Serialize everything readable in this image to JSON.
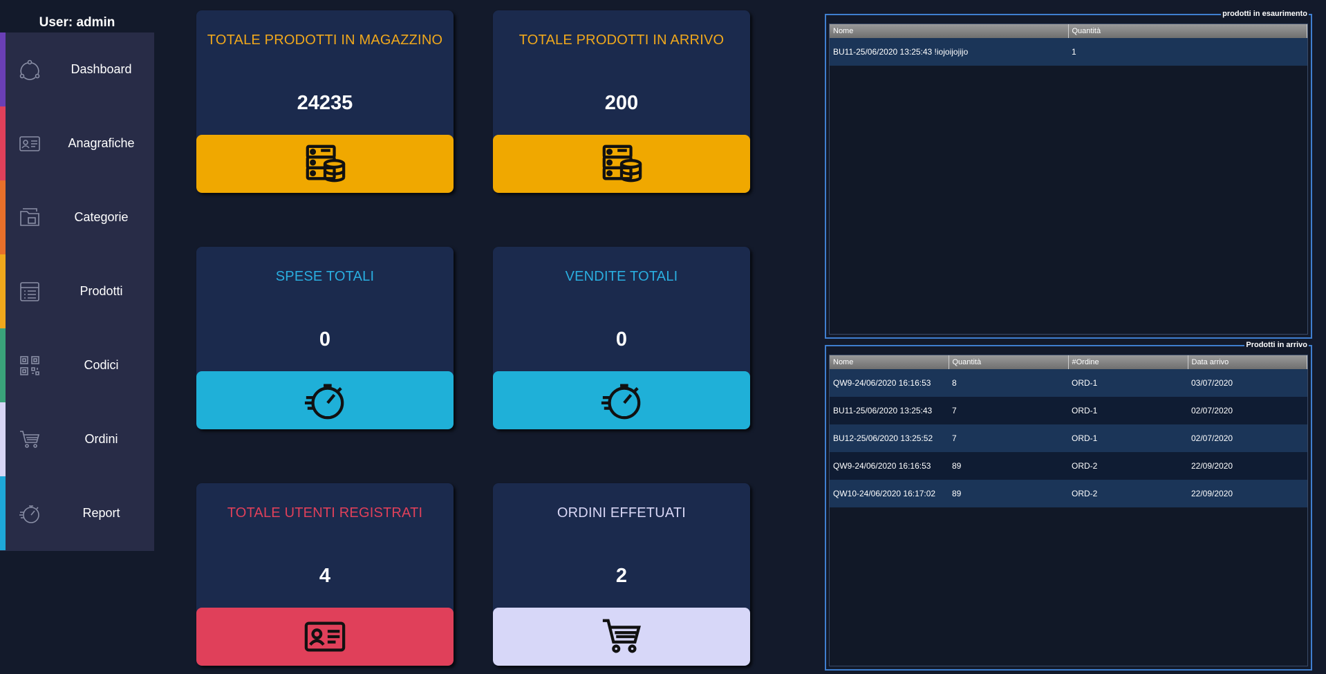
{
  "user_label": "User: admin",
  "sidebar": {
    "items": [
      {
        "label": "Dashboard",
        "icon": "dashboard-icon",
        "color": "#6a3fb5"
      },
      {
        "label": "Anagrafiche",
        "icon": "id-card-icon",
        "color": "#e0405a"
      },
      {
        "label": "Categorie",
        "icon": "folder-icon",
        "color": "#e8702a"
      },
      {
        "label": "Prodotti",
        "icon": "list-icon",
        "color": "#f0a81c"
      },
      {
        "label": "Codici",
        "icon": "qr-code-icon",
        "color": "#3aa37a"
      },
      {
        "label": "Ordini",
        "icon": "cart-icon",
        "color": "#d8d6f5"
      },
      {
        "label": "Report",
        "icon": "stopwatch-icon",
        "color": "#1ea8d8"
      }
    ]
  },
  "cards": [
    {
      "title": "TOTALE PRODOTTI IN MAGAZZINO",
      "value": "24235",
      "title_color": "#f0a81c",
      "bottom_color": "#f0a800",
      "icon": "database-icon"
    },
    {
      "title": "TOTALE PRODOTTI IN ARRIVO",
      "value": "200",
      "title_color": "#f0a81c",
      "bottom_color": "#f0a800",
      "icon": "database-icon"
    },
    {
      "title": "SPESE TOTALI",
      "value": "0",
      "title_color": "#2aaee0",
      "bottom_color": "#1fb0d8",
      "icon": "stopwatch-icon"
    },
    {
      "title": "VENDITE TOTALI",
      "value": "0",
      "title_color": "#2aaee0",
      "bottom_color": "#1fb0d8",
      "icon": "stopwatch-icon"
    },
    {
      "title": "TOTALE UTENTI REGISTRATI",
      "value": "4",
      "title_color": "#e0405a",
      "bottom_color": "#e0405a",
      "icon": "id-card-icon"
    },
    {
      "title": "ORDINI EFFETUATI",
      "value": "2",
      "title_color": "#d8d6f5",
      "bottom_color": "#d7d7f8",
      "icon": "cart-icon"
    }
  ],
  "low_stock": {
    "title": "prodotti in esaurimento",
    "columns": [
      "Nome",
      "Quantità"
    ],
    "rows": [
      [
        "BU11-25/06/2020 13:25:43  !iojoijojijo",
        "1"
      ]
    ]
  },
  "incoming": {
    "title": "Prodotti in arrivo",
    "columns": [
      "Nome",
      "Quantità",
      "#Ordine",
      "Data arrivo"
    ],
    "rows": [
      [
        "QW9-24/06/2020 16:16:53",
        "8",
        "ORD-1",
        "03/07/2020"
      ],
      [
        "BU11-25/06/2020 13:25:43",
        "7",
        "ORD-1",
        "02/07/2020"
      ],
      [
        "BU12-25/06/2020 13:25:52",
        "7",
        "ORD-1",
        "02/07/2020"
      ],
      [
        "QW9-24/06/2020 16:16:53",
        "89",
        "ORD-2",
        "22/09/2020"
      ],
      [
        "QW10-24/06/2020 16:17:02",
        "89",
        "ORD-2",
        "22/09/2020"
      ]
    ]
  }
}
